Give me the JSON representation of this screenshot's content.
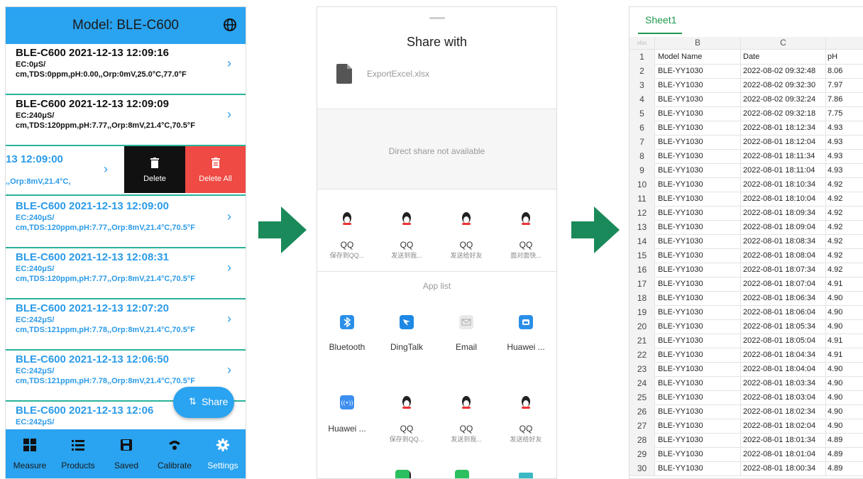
{
  "phone_app": {
    "title": "Model: BLE-C600",
    "records": [
      {
        "header": "BLE-C600   2021-12-13 12:09:16",
        "detail": "EC:0μS/ cm,TDS:0ppm,pH:0.00,,Orp:0mV,25.0°C,77.0°F",
        "style": "dark"
      },
      {
        "header": "BLE-C600   2021-12-13 12:09:09",
        "detail": "EC:240μS/ cm,TDS:120ppm,pH:7.77,,Orp:8mV,21.4°C,70.5°F",
        "style": "dark"
      },
      {
        "header": "BLE-C600   2021-12-13 12:09:00",
        "detail": "EC:240μS/ cm,TDS:120ppm,pH:7.77,,Orp:8mV,21.4°C,70.5°F",
        "style": "blue"
      },
      {
        "header": "BLE-C600   2021-12-13 12:08:31",
        "detail": "EC:240μS/ cm,TDS:120ppm,pH:7.77,,Orp:8mV,21.4°C,70.5°F",
        "style": "blue"
      },
      {
        "header": "BLE-C600   2021-12-13 12:07:20",
        "detail": "EC:242μS/ cm,TDS:121ppm,pH:7.78,,Orp:8mV,21.4°C,70.5°F",
        "style": "blue"
      },
      {
        "header": "BLE-C600   2021-12-13 12:06:50",
        "detail": "EC:242μS/ cm,TDS:121ppm,pH:7.78,,Orp:8mV,21.4°C,70.5°F",
        "style": "blue"
      },
      {
        "header": "BLE-C600   2021-12-13 12:06",
        "detail": "EC:242μS/",
        "style": "blue"
      }
    ],
    "swiped_row": {
      "line1": "13 12:09:00",
      "line2": ",,Orp:8mV,21.4°C,",
      "delete_label": "Delete",
      "delete_all_label": "Delete All"
    },
    "share_label": "Share",
    "nav": [
      {
        "label": "Measure",
        "icon": "measure-icon"
      },
      {
        "label": "Products",
        "icon": "list-icon"
      },
      {
        "label": "Saved",
        "icon": "save-icon"
      },
      {
        "label": "Calibrate",
        "icon": "calibrate-icon"
      },
      {
        "label": "Settings",
        "icon": "gear-icon"
      }
    ],
    "colors": {
      "primary": "#2aa3f0",
      "divider": "#29b39a",
      "delete": "#111111",
      "delete_all": "#ef4a43"
    }
  },
  "share_sheet": {
    "title": "Share with",
    "file_name": "ExportExcel.xlsx",
    "direct_share": "Direct share not available",
    "qq_row": [
      {
        "name": "QQ",
        "sub": "保存到QQ..."
      },
      {
        "name": "QQ",
        "sub": "发送到我..."
      },
      {
        "name": "QQ",
        "sub": "发送给好友"
      },
      {
        "name": "QQ",
        "sub": "面对面快..."
      }
    ],
    "app_list_label": "App list",
    "apps_row1": [
      {
        "name": "Bluetooth",
        "icon": "bluetooth-icon"
      },
      {
        "name": "DingTalk",
        "icon": "dingtalk-icon"
      },
      {
        "name": "Email",
        "icon": "email-icon"
      },
      {
        "name": "Huawei ...",
        "icon": "huawei-icon"
      }
    ],
    "apps_row2": [
      {
        "name": "Huawei ...",
        "sub": "",
        "icon": "huawei-share-icon"
      },
      {
        "name": "QQ",
        "sub": "保存到QQ...",
        "icon": "qq-icon"
      },
      {
        "name": "QQ",
        "sub": "发送到我...",
        "icon": "qq-icon"
      },
      {
        "name": "QQ",
        "sub": "发送给好友",
        "icon": "qq-icon"
      }
    ]
  },
  "spreadsheet": {
    "sheet_tab": "Sheet1",
    "corner": "xlsx",
    "columns": [
      "B",
      "C",
      ""
    ],
    "header_row": {
      "num": "1",
      "b": "Model Name",
      "c": "Date",
      "d": "pH"
    },
    "rows": [
      {
        "num": "2",
        "b": "BLE-YY1030",
        "c": "2022-08-02 09:32:48",
        "d": "8.06"
      },
      {
        "num": "3",
        "b": "BLE-YY1030",
        "c": "2022-08-02 09:32:30",
        "d": "7.97"
      },
      {
        "num": "4",
        "b": "BLE-YY1030",
        "c": "2022-08-02 09:32:24",
        "d": "7.86"
      },
      {
        "num": "5",
        "b": "BLE-YY1030",
        "c": "2022-08-02 09:32:18",
        "d": "7.75"
      },
      {
        "num": "6",
        "b": "BLE-YY1030",
        "c": "2022-08-01 18:12:34",
        "d": "4.93"
      },
      {
        "num": "7",
        "b": "BLE-YY1030",
        "c": "2022-08-01 18:12:04",
        "d": "4.93"
      },
      {
        "num": "8",
        "b": "BLE-YY1030",
        "c": "2022-08-01 18:11:34",
        "d": "4.93"
      },
      {
        "num": "9",
        "b": "BLE-YY1030",
        "c": "2022-08-01 18:11:04",
        "d": "4.93"
      },
      {
        "num": "10",
        "b": "BLE-YY1030",
        "c": "2022-08-01 18:10:34",
        "d": "4.92"
      },
      {
        "num": "11",
        "b": "BLE-YY1030",
        "c": "2022-08-01 18:10:04",
        "d": "4.92"
      },
      {
        "num": "12",
        "b": "BLE-YY1030",
        "c": "2022-08-01 18:09:34",
        "d": "4.92"
      },
      {
        "num": "13",
        "b": "BLE-YY1030",
        "c": "2022-08-01 18:09:04",
        "d": "4.92"
      },
      {
        "num": "14",
        "b": "BLE-YY1030",
        "c": "2022-08-01 18:08:34",
        "d": "4.92"
      },
      {
        "num": "15",
        "b": "BLE-YY1030",
        "c": "2022-08-01 18:08:04",
        "d": "4.92"
      },
      {
        "num": "16",
        "b": "BLE-YY1030",
        "c": "2022-08-01 18:07:34",
        "d": "4.92"
      },
      {
        "num": "17",
        "b": "BLE-YY1030",
        "c": "2022-08-01 18:07:04",
        "d": "4.91"
      },
      {
        "num": "18",
        "b": "BLE-YY1030",
        "c": "2022-08-01 18:06:34",
        "d": "4.90"
      },
      {
        "num": "19",
        "b": "BLE-YY1030",
        "c": "2022-08-01 18:06:04",
        "d": "4.90"
      },
      {
        "num": "20",
        "b": "BLE-YY1030",
        "c": "2022-08-01 18:05:34",
        "d": "4.90"
      },
      {
        "num": "21",
        "b": "BLE-YY1030",
        "c": "2022-08-01 18:05:04",
        "d": "4.91"
      },
      {
        "num": "22",
        "b": "BLE-YY1030",
        "c": "2022-08-01 18:04:34",
        "d": "4.91"
      },
      {
        "num": "23",
        "b": "BLE-YY1030",
        "c": "2022-08-01 18:04:04",
        "d": "4.90"
      },
      {
        "num": "24",
        "b": "BLE-YY1030",
        "c": "2022-08-01 18:03:34",
        "d": "4.90"
      },
      {
        "num": "25",
        "b": "BLE-YY1030",
        "c": "2022-08-01 18:03:04",
        "d": "4.90"
      },
      {
        "num": "26",
        "b": "BLE-YY1030",
        "c": "2022-08-01 18:02:34",
        "d": "4.90"
      },
      {
        "num": "27",
        "b": "BLE-YY1030",
        "c": "2022-08-01 18:02:04",
        "d": "4.90"
      },
      {
        "num": "28",
        "b": "BLE-YY1030",
        "c": "2022-08-01 18:01:34",
        "d": "4.89"
      },
      {
        "num": "29",
        "b": "BLE-YY1030",
        "c": "2022-08-01 18:01:04",
        "d": "4.89"
      },
      {
        "num": "30",
        "b": "BLE-YY1030",
        "c": "2022-08-01 18:00:34",
        "d": "4.89"
      }
    ],
    "accent": "#1f9a4e"
  },
  "arrows": {
    "color": "#1a8a5a",
    "icon": "arrow-right-icon"
  }
}
